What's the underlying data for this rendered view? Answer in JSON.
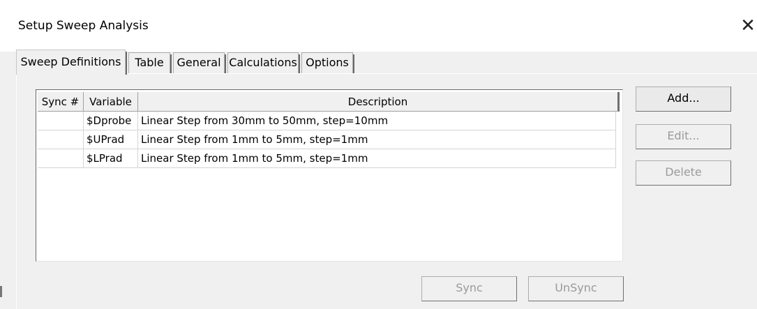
{
  "window": {
    "title": "Setup Sweep Analysis",
    "close_glyph": "✕"
  },
  "tabs": [
    {
      "label": "Sweep Definitions",
      "active": true
    },
    {
      "label": "Table",
      "active": false
    },
    {
      "label": "General",
      "active": false
    },
    {
      "label": "Calculations",
      "active": false
    },
    {
      "label": "Options",
      "active": false
    }
  ],
  "table": {
    "columns": [
      "Sync #",
      "Variable",
      "Description"
    ],
    "rows": [
      {
        "sync": "",
        "variable": "$Dprobe",
        "description": "Linear Step from 30mm to 50mm, step=10mm"
      },
      {
        "sync": "",
        "variable": "$UPrad",
        "description": "Linear Step from 1mm to 5mm, step=1mm"
      },
      {
        "sync": "",
        "variable": "$LPrad",
        "description": "Linear Step from 1mm to 5mm, step=1mm"
      }
    ]
  },
  "buttons": {
    "add": {
      "label": "Add...",
      "enabled": true
    },
    "edit": {
      "label": "Edit...",
      "enabled": false
    },
    "delete": {
      "label": "Delete",
      "enabled": false
    },
    "sync": {
      "label": "Sync",
      "enabled": false
    },
    "unsync": {
      "label": "UnSync",
      "enabled": false
    }
  },
  "colors": {
    "title_bar": "#ffffff",
    "dialog_bg": "#f0f0f0",
    "disabled_text": "#9a9a9a"
  }
}
